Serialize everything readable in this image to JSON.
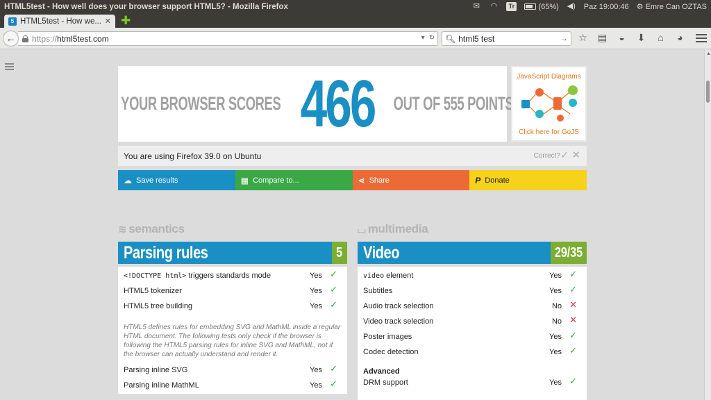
{
  "system": {
    "window_title": "HTML5test - How well does your browser support HTML5? - Mozilla Firefox",
    "keyboard_layout": "Tr",
    "battery": "(65%)",
    "clock": "Paz 19:00:46",
    "user": "Emre Can OZTAS"
  },
  "browser": {
    "tab_title": "HTML5test - How we...",
    "url_protocol": "https://",
    "url_host": "html5test.com",
    "search_value": "html5 test"
  },
  "score": {
    "left_text": "YOUR BROWSER SCORES",
    "points": "466",
    "right_text": "OUT OF 555 POINTS"
  },
  "ad": {
    "title": "JavaScript Diagrams",
    "link": "Click here for GoJS"
  },
  "info": {
    "message": "You are using Firefox 39.0 on Ubuntu",
    "correct_label": "Correct?"
  },
  "actions": {
    "save": "Save results",
    "compare": "Compare to...",
    "share": "Share",
    "donate": "Donate"
  },
  "semantics": {
    "heading": "semantics",
    "category": "Parsing rules",
    "score": "5",
    "rows": [
      {
        "pre": "<!DOCTYPE html>",
        "label": " triggers standards mode",
        "value": "Yes",
        "status": "ok"
      },
      {
        "pre": "",
        "label": "HTML5 tokenizer",
        "value": "Yes",
        "status": "ok"
      },
      {
        "pre": "",
        "label": "HTML5 tree building",
        "value": "Yes",
        "status": "ok"
      }
    ],
    "note": "HTML5 defines rules for embedding SVG and MathML inside a regular HTML document. The following tests only check if the browser is following the HTML5 parsing rules for inline SVG and MathML, not if the browser can actually understand and render it.",
    "rows2": [
      {
        "label": "Parsing inline SVG",
        "value": "Yes",
        "status": "ok"
      },
      {
        "label": "Parsing inline MathML",
        "value": "Yes",
        "status": "ok"
      }
    ]
  },
  "multimedia": {
    "heading": "multimedia",
    "category": "Video",
    "score": "29/35",
    "rows": [
      {
        "label": "video",
        "suffix": " element",
        "mono": true,
        "value": "Yes",
        "status": "ok"
      },
      {
        "label": "Subtitles",
        "suffix": "",
        "mono": false,
        "value": "Yes",
        "status": "ok"
      },
      {
        "label": "Audio track selection",
        "suffix": "",
        "mono": false,
        "value": "No",
        "status": "no"
      },
      {
        "label": "Video track selection",
        "suffix": "",
        "mono": false,
        "value": "No",
        "status": "no"
      },
      {
        "label": "Poster images",
        "suffix": "",
        "mono": false,
        "value": "Yes",
        "status": "ok"
      },
      {
        "label": "Codec detection",
        "suffix": "",
        "mono": false,
        "value": "Yes",
        "status": "ok"
      }
    ],
    "subhead": "Advanced",
    "rows2": [
      {
        "label": "DRM support",
        "value": "Yes",
        "status": "ok"
      }
    ]
  },
  "colors": {
    "blue": "#1a8fc4",
    "green": "#39a845",
    "orange": "#ec6a36",
    "yellow": "#f7d21a",
    "score_green": "#7cae32",
    "fail_red": "#d23b3b"
  }
}
